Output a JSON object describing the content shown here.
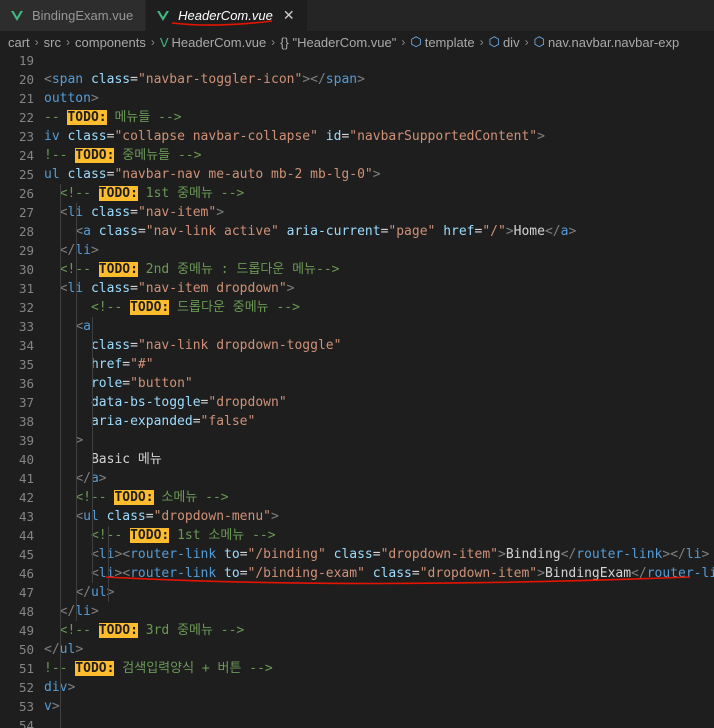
{
  "tabs": [
    {
      "label": "BindingExam.vue",
      "active": false
    },
    {
      "label": "HeaderCom.vue",
      "active": true,
      "close": "✕"
    }
  ],
  "breadcrumb": [
    "cart",
    "src",
    "components",
    "HeaderCom.vue",
    "{} \"HeaderCom.vue\"",
    "template",
    "div",
    "nav.navbar.navbar-exp"
  ],
  "code_lines": [
    {
      "n": "19",
      "tokens": []
    },
    {
      "n": "20",
      "tokens": [
        [
          "p",
          "<"
        ],
        [
          "t",
          "span"
        ],
        [
          "a",
          " class"
        ],
        [
          "x",
          "="
        ],
        [
          "s",
          "\"navbar-toggler-icon\""
        ],
        [
          "p",
          "></"
        ],
        [
          "t",
          "span"
        ],
        [
          "p",
          ">"
        ]
      ]
    },
    {
      "n": "21",
      "tokens": [
        [
          "t",
          "outton"
        ],
        [
          "p",
          ">"
        ]
      ]
    },
    {
      "n": "22",
      "tokens": [
        [
          "c",
          "-- "
        ],
        [
          "todo",
          "TODO:"
        ],
        [
          "c",
          " 메뉴들 -->"
        ]
      ]
    },
    {
      "n": "23",
      "tokens": [
        [
          "t",
          "iv"
        ],
        [
          "a",
          " class"
        ],
        [
          "x",
          "="
        ],
        [
          "s",
          "\"collapse navbar-collapse\""
        ],
        [
          "a",
          " id"
        ],
        [
          "x",
          "="
        ],
        [
          "s",
          "\"navbarSupportedContent\""
        ],
        [
          "p",
          ">"
        ]
      ]
    },
    {
      "n": "24",
      "tokens": [
        [
          "c",
          "!-- "
        ],
        [
          "todo",
          "TODO:"
        ],
        [
          "c",
          " 중메뉴들 -->"
        ]
      ]
    },
    {
      "n": "25",
      "tokens": [
        [
          "t",
          "ul"
        ],
        [
          "a",
          " class"
        ],
        [
          "x",
          "="
        ],
        [
          "s",
          "\"navbar-nav me-auto mb-2 mb-lg-0\""
        ],
        [
          "p",
          ">"
        ]
      ]
    },
    {
      "n": "26",
      "tokens": [
        [
          "x",
          "  "
        ],
        [
          "c",
          "<!-- "
        ],
        [
          "todo",
          "TODO:"
        ],
        [
          "c",
          " 1st 중메뉴 -->"
        ]
      ]
    },
    {
      "n": "27",
      "tokens": [
        [
          "x",
          "  "
        ],
        [
          "p",
          "<"
        ],
        [
          "t",
          "li"
        ],
        [
          "a",
          " class"
        ],
        [
          "x",
          "="
        ],
        [
          "s",
          "\"nav-item\""
        ],
        [
          "p",
          ">"
        ]
      ]
    },
    {
      "n": "28",
      "tokens": [
        [
          "x",
          "    "
        ],
        [
          "p",
          "<"
        ],
        [
          "t",
          "a"
        ],
        [
          "a",
          " class"
        ],
        [
          "x",
          "="
        ],
        [
          "s",
          "\"nav-link active\""
        ],
        [
          "a",
          " aria-current"
        ],
        [
          "x",
          "="
        ],
        [
          "s",
          "\"page\""
        ],
        [
          "a",
          " href"
        ],
        [
          "x",
          "="
        ],
        [
          "s",
          "\"/\""
        ],
        [
          "p",
          ">"
        ],
        [
          "x",
          "Home"
        ],
        [
          "p",
          "</"
        ],
        [
          "t",
          "a"
        ],
        [
          "p",
          ">"
        ]
      ]
    },
    {
      "n": "29",
      "tokens": [
        [
          "x",
          "  "
        ],
        [
          "p",
          "</"
        ],
        [
          "t",
          "li"
        ],
        [
          "p",
          ">"
        ]
      ]
    },
    {
      "n": "30",
      "tokens": [
        [
          "x",
          "  "
        ],
        [
          "c",
          "<!-- "
        ],
        [
          "todo",
          "TODO:"
        ],
        [
          "c",
          " 2nd 중메뉴 : 드롭다운 메뉴-->"
        ]
      ]
    },
    {
      "n": "31",
      "tokens": [
        [
          "x",
          "  "
        ],
        [
          "p",
          "<"
        ],
        [
          "t",
          "li"
        ],
        [
          "a",
          " class"
        ],
        [
          "x",
          "="
        ],
        [
          "s",
          "\"nav-item dropdown\""
        ],
        [
          "p",
          ">"
        ]
      ]
    },
    {
      "n": "32",
      "tokens": [
        [
          "x",
          "      "
        ],
        [
          "c",
          "<!-- "
        ],
        [
          "todo",
          "TODO:"
        ],
        [
          "c",
          " 드롭다운 중메뉴 -->"
        ]
      ]
    },
    {
      "n": "33",
      "tokens": [
        [
          "x",
          "    "
        ],
        [
          "p",
          "<"
        ],
        [
          "t",
          "a"
        ]
      ]
    },
    {
      "n": "34",
      "tokens": [
        [
          "x",
          "      "
        ],
        [
          "a",
          "class"
        ],
        [
          "x",
          "="
        ],
        [
          "s",
          "\"nav-link dropdown-toggle\""
        ]
      ]
    },
    {
      "n": "35",
      "tokens": [
        [
          "x",
          "      "
        ],
        [
          "a",
          "href"
        ],
        [
          "x",
          "="
        ],
        [
          "s",
          "\"#\""
        ]
      ]
    },
    {
      "n": "36",
      "tokens": [
        [
          "x",
          "      "
        ],
        [
          "a",
          "role"
        ],
        [
          "x",
          "="
        ],
        [
          "s",
          "\"button\""
        ]
      ]
    },
    {
      "n": "37",
      "tokens": [
        [
          "x",
          "      "
        ],
        [
          "a",
          "data-bs-toggle"
        ],
        [
          "x",
          "="
        ],
        [
          "s",
          "\"dropdown\""
        ]
      ]
    },
    {
      "n": "38",
      "tokens": [
        [
          "x",
          "      "
        ],
        [
          "a",
          "aria-expanded"
        ],
        [
          "x",
          "="
        ],
        [
          "s",
          "\"false\""
        ]
      ]
    },
    {
      "n": "39",
      "tokens": [
        [
          "x",
          "    "
        ],
        [
          "p",
          ">"
        ]
      ]
    },
    {
      "n": "40",
      "tokens": [
        [
          "x",
          "      Basic 메뉴"
        ]
      ]
    },
    {
      "n": "41",
      "tokens": [
        [
          "x",
          "    "
        ],
        [
          "p",
          "</"
        ],
        [
          "t",
          "a"
        ],
        [
          "p",
          ">"
        ]
      ]
    },
    {
      "n": "42",
      "tokens": [
        [
          "x",
          "    "
        ],
        [
          "c",
          "<!-- "
        ],
        [
          "todo",
          "TODO:"
        ],
        [
          "c",
          " 소메뉴 -->"
        ]
      ]
    },
    {
      "n": "43",
      "tokens": [
        [
          "x",
          "    "
        ],
        [
          "p",
          "<"
        ],
        [
          "t",
          "ul"
        ],
        [
          "a",
          " class"
        ],
        [
          "x",
          "="
        ],
        [
          "s",
          "\"dropdown-menu\""
        ],
        [
          "p",
          ">"
        ]
      ]
    },
    {
      "n": "44",
      "tokens": [
        [
          "x",
          "      "
        ],
        [
          "c",
          "<!-- "
        ],
        [
          "todo",
          "TODO:"
        ],
        [
          "c",
          " 1st 소메뉴 -->"
        ]
      ]
    },
    {
      "n": "45",
      "tokens": [
        [
          "x",
          "      "
        ],
        [
          "p",
          "<"
        ],
        [
          "t",
          "li"
        ],
        [
          "p",
          "><"
        ],
        [
          "t",
          "router-link"
        ],
        [
          "a",
          " to"
        ],
        [
          "x",
          "="
        ],
        [
          "s",
          "\"/binding\""
        ],
        [
          "a",
          " class"
        ],
        [
          "x",
          "="
        ],
        [
          "s",
          "\"dropdown-item\""
        ],
        [
          "p",
          ">"
        ],
        [
          "x",
          "Binding"
        ],
        [
          "p",
          "</"
        ],
        [
          "t",
          "router-link"
        ],
        [
          "p",
          "></"
        ],
        [
          "t",
          "li"
        ],
        [
          "p",
          ">"
        ]
      ]
    },
    {
      "n": "46",
      "tokens": [
        [
          "x",
          "      "
        ],
        [
          "p",
          "<"
        ],
        [
          "t",
          "li"
        ],
        [
          "p",
          "><"
        ],
        [
          "t",
          "router-link"
        ],
        [
          "a",
          " to"
        ],
        [
          "x",
          "="
        ],
        [
          "s",
          "\"/binding-exam\""
        ],
        [
          "a",
          " class"
        ],
        [
          "x",
          "="
        ],
        [
          "s",
          "\"dropdown-item\""
        ],
        [
          "p",
          ">"
        ],
        [
          "x",
          "BindingExam"
        ],
        [
          "p",
          "</"
        ],
        [
          "t",
          "router-li"
        ]
      ]
    },
    {
      "n": "47",
      "tokens": [
        [
          "x",
          "    "
        ],
        [
          "p",
          "</"
        ],
        [
          "t",
          "ul"
        ],
        [
          "p",
          ">"
        ]
      ]
    },
    {
      "n": "48",
      "tokens": [
        [
          "x",
          "  "
        ],
        [
          "p",
          "</"
        ],
        [
          "t",
          "li"
        ],
        [
          "p",
          ">"
        ]
      ]
    },
    {
      "n": "49",
      "tokens": [
        [
          "x",
          "  "
        ],
        [
          "c",
          "<!-- "
        ],
        [
          "todo",
          "TODO:"
        ],
        [
          "c",
          " 3rd 중메뉴 -->"
        ]
      ]
    },
    {
      "n": "50",
      "tokens": [
        [
          "p",
          "</"
        ],
        [
          "t",
          "ul"
        ],
        [
          "p",
          ">"
        ]
      ]
    },
    {
      "n": "51",
      "tokens": [
        [
          "c",
          "!-- "
        ],
        [
          "todo",
          "TODO:"
        ],
        [
          "c",
          " 검색입력양식 + 버튼 -->"
        ]
      ]
    },
    {
      "n": "52",
      "tokens": [
        [
          "t",
          "div"
        ],
        [
          "p",
          ">"
        ]
      ]
    },
    {
      "n": "53",
      "tokens": [
        [
          "t",
          "v"
        ],
        [
          "p",
          ">"
        ]
      ]
    },
    {
      "n": "54",
      "tokens": []
    }
  ],
  "colors": {
    "background": "#1e1e1e",
    "todo_highlight": "#ffbd2e",
    "annotation_stroke": "#e51400"
  }
}
